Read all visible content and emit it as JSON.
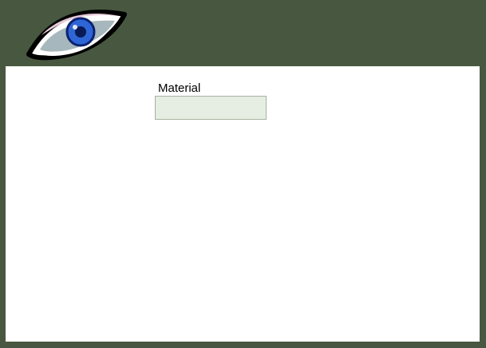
{
  "header": {
    "logo_icon": "eye-icon"
  },
  "form": {
    "material": {
      "label": "Material",
      "value": "",
      "placeholder": ""
    }
  },
  "colors": {
    "frame": "#485840",
    "panel": "#ffffff",
    "input_fill": "#e6ede2",
    "input_border": "#a8b2a0",
    "iris": "#2e66d6"
  }
}
